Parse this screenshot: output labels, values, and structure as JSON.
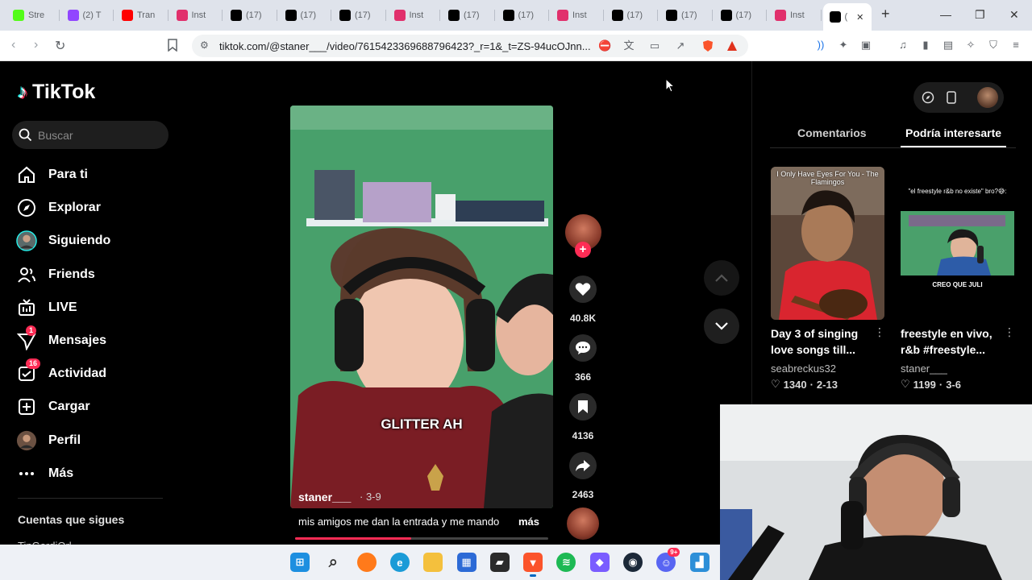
{
  "browser": {
    "tabs": [
      {
        "label": "Stre",
        "icon": "kick-icon",
        "color": "#53fc18"
      },
      {
        "label": "(2) T",
        "icon": "twitch-icon",
        "color": "#9146ff"
      },
      {
        "label": "Tran",
        "icon": "youtube-icon",
        "color": "#ff0000"
      },
      {
        "label": "Inst",
        "icon": "instagram-icon",
        "color": "#e1306c"
      },
      {
        "label": "(17)",
        "icon": "tiktok-icon",
        "color": "#000000"
      },
      {
        "label": "(17)",
        "icon": "tiktok-icon",
        "color": "#000000"
      },
      {
        "label": "(17)",
        "icon": "tiktok-icon",
        "color": "#000000"
      },
      {
        "label": "Inst",
        "icon": "instagram-icon",
        "color": "#e1306c"
      },
      {
        "label": "(17)",
        "icon": "tiktok-icon",
        "color": "#000000"
      },
      {
        "label": "(17)",
        "icon": "tiktok-icon",
        "color": "#000000"
      },
      {
        "label": "Inst",
        "icon": "instagram-icon",
        "color": "#e1306c"
      },
      {
        "label": "(17)",
        "icon": "tiktok-icon",
        "color": "#000000"
      },
      {
        "label": "(17)",
        "icon": "tiktok-icon",
        "color": "#000000"
      },
      {
        "label": "(17)",
        "icon": "tiktok-icon",
        "color": "#000000"
      },
      {
        "label": "Inst",
        "icon": "instagram-icon",
        "color": "#e1306c"
      },
      {
        "label": "(",
        "icon": "audio-icon",
        "color": "#000000",
        "active": true
      }
    ],
    "url": "tiktok.com/@staner___/video/7615423369688796423?_r=1&_t=ZS-94ucOJnn..."
  },
  "tiktok": {
    "logo": "TikTok",
    "search_placeholder": "Buscar",
    "nav": [
      {
        "label": "Para ti",
        "icon": "home-icon"
      },
      {
        "label": "Explorar",
        "icon": "compass-icon"
      },
      {
        "label": "Siguiendo",
        "icon": "following-avatar-icon"
      },
      {
        "label": "Friends",
        "icon": "friends-icon"
      },
      {
        "label": "LIVE",
        "icon": "live-icon"
      },
      {
        "label": "Mensajes",
        "icon": "messages-icon",
        "badge": "1"
      },
      {
        "label": "Actividad",
        "icon": "activity-icon",
        "badge": "16"
      },
      {
        "label": "Cargar",
        "icon": "upload-icon"
      },
      {
        "label": "Perfil",
        "icon": "profile-avatar-icon"
      },
      {
        "label": "Más",
        "icon": "more-icon"
      }
    ],
    "following_title": "Cuentas que sigues",
    "following_partial": "TinGordiOrl..."
  },
  "video": {
    "overlay_caption": "GLITTER AH",
    "author": "staner___",
    "date": "· 3-9",
    "description": "mis amigos me dan la entrada y me mando",
    "more": "más",
    "progress": 0.46,
    "actions": {
      "likes": "40.8K",
      "comments": "366",
      "saves": "4136",
      "shares": "2463"
    }
  },
  "right_panel": {
    "tabs": [
      "Comentarios",
      "Podría interesarte"
    ],
    "active_tab": 1,
    "cards": [
      {
        "thumb_caption": "I Only Have Eyes For You - The Flamingos",
        "title": "Day 3 of singing love songs till...",
        "author": "seabreckus32",
        "likes": "1340",
        "date": "2-13"
      },
      {
        "thumb_caption": "\"el freestyle r&b no existe\" bro?😅:",
        "thumb_bottom": "CREO QUE JULI",
        "title": "freestyle en vivo, r&b #freestyle...",
        "author": "staner___",
        "likes": "1199",
        "date": "3-6"
      }
    ]
  },
  "taskbar": {
    "icons": [
      "windows-start-icon",
      "search-icon",
      "firefox-icon",
      "edge-icon",
      "file-explorer-icon",
      "store-icon",
      "sticky-notes-icon",
      "brave-icon",
      "spotify-icon",
      "app-icon",
      "steam-icon",
      "discord-icon",
      "photos-icon"
    ],
    "discord_badge": "9+"
  }
}
